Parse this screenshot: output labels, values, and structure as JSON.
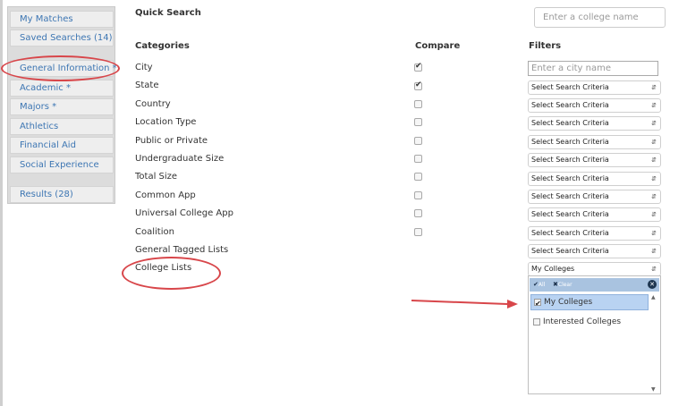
{
  "sidebar": {
    "items": [
      {
        "label": "My Matches"
      },
      {
        "label": "Saved Searches (14)"
      },
      {
        "label": "General Information *"
      },
      {
        "label": "Academic *"
      },
      {
        "label": "Majors *"
      },
      {
        "label": "Athletics"
      },
      {
        "label": "Financial Aid"
      },
      {
        "label": "Social Experience"
      },
      {
        "label": "Results (28)"
      }
    ]
  },
  "quick_search": {
    "title": "Quick Search",
    "placeholder": "Enter a college name"
  },
  "columns": {
    "categories": "Categories",
    "compare": "Compare",
    "filters": "Filters"
  },
  "categories": [
    {
      "label": "City",
      "compare": true
    },
    {
      "label": "State",
      "compare": true
    },
    {
      "label": "Country",
      "compare": false
    },
    {
      "label": "Location Type",
      "compare": false
    },
    {
      "label": "Public or Private",
      "compare": false
    },
    {
      "label": "Undergraduate Size",
      "compare": false
    },
    {
      "label": "Total Size",
      "compare": false
    },
    {
      "label": "Common App",
      "compare": false
    },
    {
      "label": "Universal College App",
      "compare": false
    },
    {
      "label": "Coalition",
      "compare": false
    },
    {
      "label": "General Tagged Lists"
    },
    {
      "label": "College Lists"
    }
  ],
  "filters": {
    "city_placeholder": "Enter a city name",
    "select_label": "Select Search Criteria",
    "college_lists_value": "My Colleges"
  },
  "dropdown": {
    "all_label": "All",
    "clear_label": "Clear",
    "options": [
      {
        "label": "My Colleges",
        "selected": true
      },
      {
        "label": "Interested Colleges",
        "selected": false
      }
    ]
  },
  "annotation_color": "#d8464a"
}
